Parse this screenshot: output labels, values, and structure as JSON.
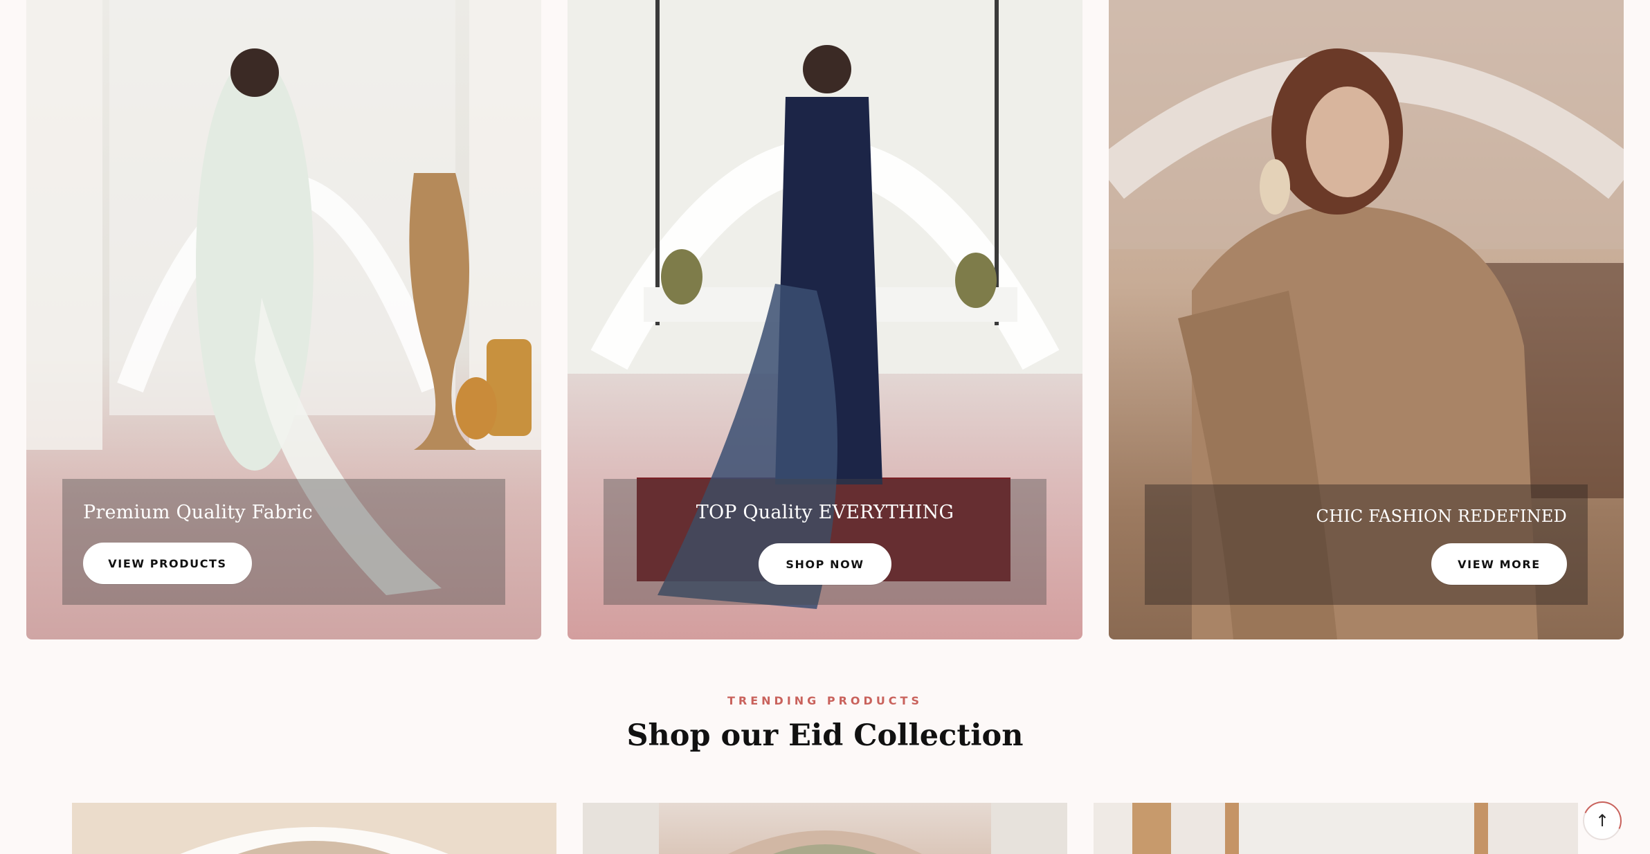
{
  "banners": [
    {
      "title": "Premium Quality Fabric",
      "button": "VIEW PRODUCTS"
    },
    {
      "title": "TOP Quality EVERYTHING",
      "button": "SHOP NOW"
    },
    {
      "title": "CHIC FASHION REDEFINED",
      "button": "VIEW MORE"
    }
  ],
  "section": {
    "eyebrow": "TRENDING PRODUCTS",
    "heading": "Shop our Eid Collection"
  },
  "scroll_top": {
    "icon": "arrow-up-icon",
    "glyph": "↑"
  },
  "colors": {
    "accent": "#c9625c",
    "heading": "#111111",
    "background": "#fdf9f8"
  }
}
